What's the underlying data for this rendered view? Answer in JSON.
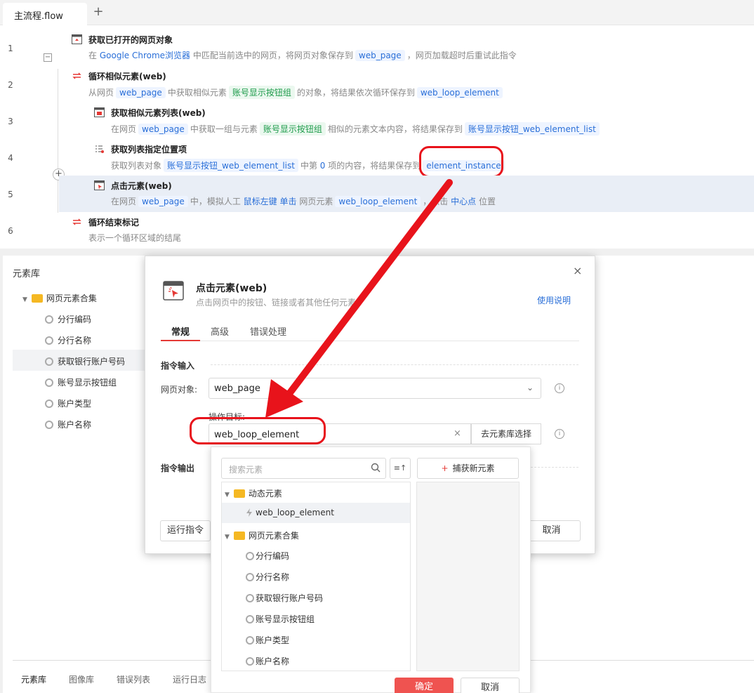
{
  "tabs": {
    "file": "主流程.flow",
    "add": "+"
  },
  "flow": {
    "steps": [
      {
        "num": "1",
        "title": "获取已打开的网页对象",
        "d1": "在",
        "d2": "Google Chrome浏览器",
        "d3": "中匹配当前选中的网页，将网页对象保存到",
        "d4": "web_page",
        "d5": "，网页加载超时后重试此指令"
      },
      {
        "num": "2",
        "title": "循环相似元素(web)",
        "d1": "从网页",
        "d2": "web_page",
        "d3": "中获取相似元素",
        "d4": "账号显示按钮组",
        "d5": "的对象，将结果依次循环保存到",
        "d6": "web_loop_element"
      },
      {
        "num": "3",
        "title": "获取相似元素列表(web)",
        "d1": "在网页",
        "d2": "web_page",
        "d3": "中获取一组与元素",
        "d4": "账号显示按钮组",
        "d5": "相似的元素文本内容，将结果保存到",
        "d6": "账号显示按钮_web_element_list"
      },
      {
        "num": "4",
        "title": "获取列表指定位置项",
        "d1": "获取列表对象",
        "d2": "账号显示按钮_web_element_list",
        "d3": "中第",
        "d4": "0",
        "d5": "项的内容，将结果保存到",
        "d6": "element_instance"
      },
      {
        "num": "5",
        "title": "点击元素(web)",
        "d1": "在网页",
        "d2": "web_page",
        "d3": "中，模拟人工",
        "d4": "鼠标左键",
        "d5": "单击",
        "d6": "网页元素",
        "d7": "web_loop_element",
        "d8": "，点击",
        "d9": "中心点",
        "d10": "位置"
      },
      {
        "num": "6",
        "title": "循环结束标记",
        "d1": "表示一个循环区域的结尾"
      }
    ],
    "collapse": "−",
    "plus": "+"
  },
  "library": {
    "title": "元素库",
    "root": "网页元素合集",
    "items": [
      "分行编码",
      "分行名称",
      "获取银行账户号码",
      "账号显示按钮组",
      "账户类型",
      "账户名称"
    ],
    "bottom_tabs": [
      "元素库",
      "图像库",
      "错误列表",
      "运行日志"
    ]
  },
  "modal": {
    "close": "×",
    "title": "点击元素(web)",
    "subtitle": "点击网页中的按钮、链接或者其他任何元素",
    "help": "使用说明",
    "tabs": [
      "常规",
      "高级",
      "错误处理"
    ],
    "input_section": "指令输入",
    "web_object_label": "网页对象:",
    "web_object_value": "web_page",
    "chevron": "⌄",
    "target_label": "操作目标:",
    "target_value": "web_loop_element",
    "target_clear": "×",
    "pick_button": "去元素库选择",
    "output_section": "指令输出",
    "run_button": "运行指令",
    "cancel_button": "取消",
    "info": "i"
  },
  "popup": {
    "search_placeholder": "搜索元素",
    "sort": "≡↑",
    "capture_plus": "+",
    "capture": "捕获新元素",
    "group1": "动态元素",
    "dynamic_item": "web_loop_element",
    "group2": "网页元素合集",
    "items": [
      "分行编码",
      "分行名称",
      "获取银行账户号码",
      "账号显示按钮组",
      "账户类型",
      "账户名称"
    ],
    "ok": "确定",
    "cancel": "取消"
  },
  "colors": {
    "accent": "#e53935",
    "link": "#2a6fd8",
    "highlight": "#e8131b"
  }
}
